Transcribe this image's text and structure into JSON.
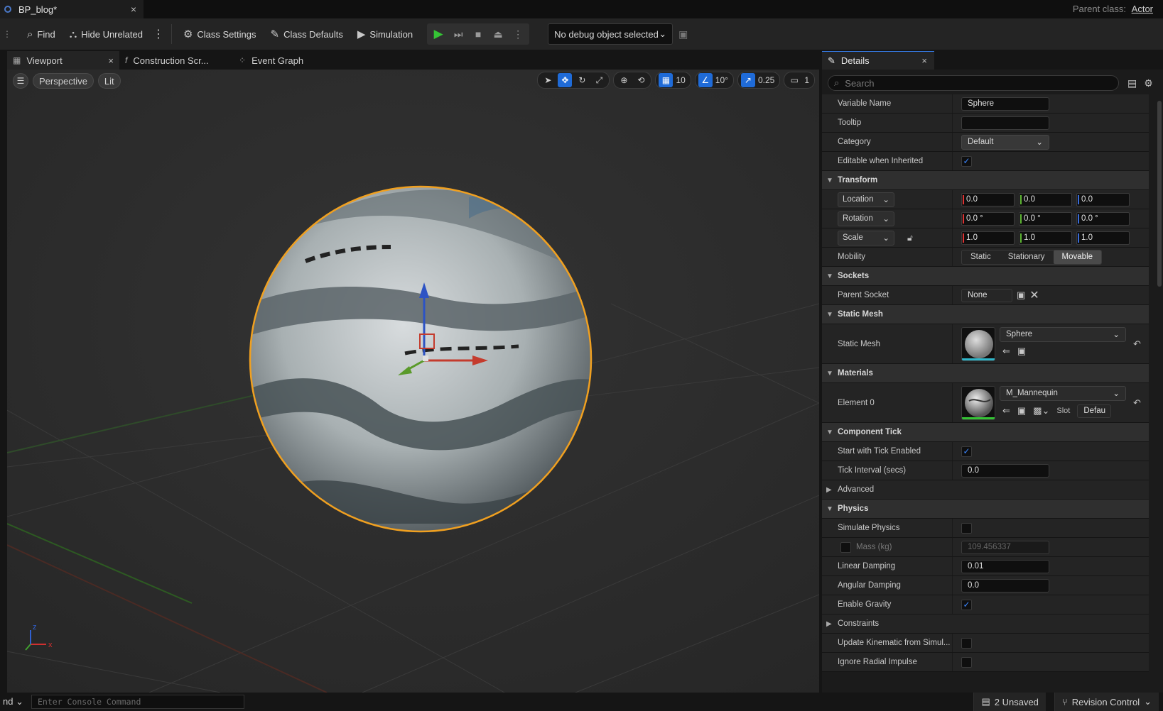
{
  "window": {
    "doc_tab": "BP_blog*",
    "parent_class_label": "Parent class:",
    "parent_class_value": "Actor"
  },
  "toolbar": {
    "find": "Find",
    "hide_unrelated": "Hide Unrelated",
    "class_settings": "Class Settings",
    "class_defaults": "Class Defaults",
    "simulation": "Simulation",
    "debug_object": "No debug object selected"
  },
  "editor_tabs": [
    "Viewport",
    "Construction Scr...",
    "Event Graph"
  ],
  "viewport": {
    "view_mode": "Perspective",
    "lighting": "Lit",
    "grid_snap": "10",
    "rotation_snap": "10°",
    "scale_snap": "0.25",
    "camera_speed": "1",
    "axis_x": "x",
    "axis_z": "z"
  },
  "details": {
    "tab": "Details",
    "search_placeholder": "Search",
    "variable_name_label": "Variable Name",
    "variable_name_value": "Sphere",
    "tooltip_label": "Tooltip",
    "category_label": "Category",
    "category_value": "Default",
    "editable_label": "Editable when Inherited",
    "transform_section": "Transform",
    "location_label": "Location",
    "location": [
      "0.0",
      "0.0",
      "0.0"
    ],
    "rotation_label": "Rotation",
    "rotation": [
      "0.0 °",
      "0.0 °",
      "0.0 °"
    ],
    "scale_label": "Scale",
    "scale": [
      "1.0",
      "1.0",
      "1.0"
    ],
    "mobility_label": "Mobility",
    "mobility_options": [
      "Static",
      "Stationary",
      "Movable"
    ],
    "mobility_selected": "Movable",
    "sockets_section": "Sockets",
    "parent_socket_label": "Parent Socket",
    "parent_socket_value": "None",
    "static_mesh_section": "Static Mesh",
    "static_mesh_label": "Static Mesh",
    "static_mesh_value": "Sphere",
    "materials_section": "Materials",
    "element0_label": "Element 0",
    "element0_value": "M_Mannequin",
    "slot_label": "Slot",
    "slot_value": "Defau",
    "component_tick_section": "Component Tick",
    "start_tick_label": "Start with Tick Enabled",
    "tick_interval_label": "Tick Interval (secs)",
    "tick_interval_value": "0.0",
    "advanced_label": "Advanced",
    "physics_section": "Physics",
    "simulate_physics_label": "Simulate Physics",
    "mass_label": "Mass (kg)",
    "mass_value": "109.456337",
    "linear_damping_label": "Linear Damping",
    "linear_damping_value": "0.01",
    "angular_damping_label": "Angular Damping",
    "angular_damping_value": "0.0",
    "enable_gravity_label": "Enable Gravity",
    "constraints_label": "Constraints",
    "update_kinematic_label": "Update Kinematic from Simul...",
    "ignore_radial_label": "Ignore Radial Impulse"
  },
  "statusbar": {
    "cmd": "nd",
    "console_placeholder": "Enter Console Command",
    "unsaved": "2 Unsaved",
    "revision_control": "Revision Control"
  },
  "colors": {
    "accent": "#3477e0",
    "selection_outline": "#f0a020",
    "play_green": "#35c435"
  }
}
